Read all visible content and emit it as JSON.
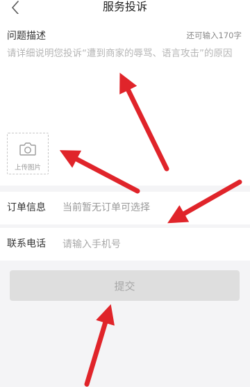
{
  "navbar": {
    "title": "服务投诉",
    "back_icon": "chevron-left-icon"
  },
  "description": {
    "label": "问题描述",
    "counter": "还可输入170字",
    "placeholder": "请详细说明您投诉“遭到商家的辱骂、语言攻击”的原因",
    "value": ""
  },
  "upload": {
    "icon": "camera-icon",
    "label": "上传图片"
  },
  "order": {
    "label": "订单信息",
    "value": "当前暂无订单可选择"
  },
  "phone": {
    "label": "联系电话",
    "placeholder": "请输入手机号",
    "value": ""
  },
  "submit": {
    "label": "提交",
    "disabled": true
  },
  "colors": {
    "background": "#f4f4f6",
    "card": "#ffffff",
    "annotation_arrow": "#e0242a",
    "button_disabled": "#dedede",
    "button_text_disabled": "#a6a6a6"
  }
}
